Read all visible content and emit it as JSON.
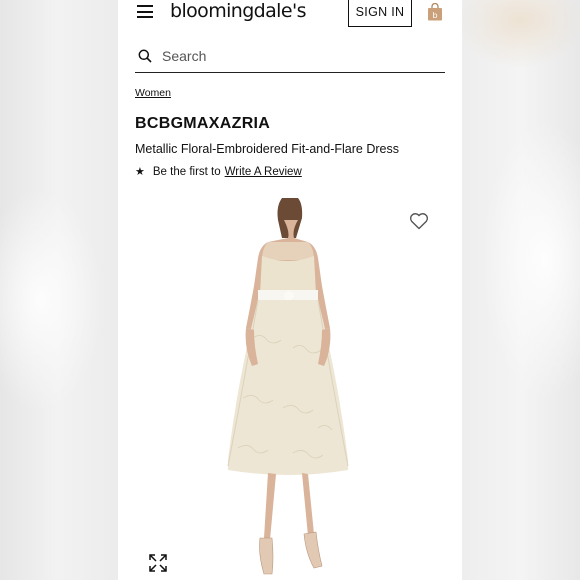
{
  "header": {
    "logo_text": "bloomingdale's",
    "signin_label": "SIGN IN",
    "bag_icon": "shopping-bag-icon",
    "menu_icon": "hamburger-menu-icon"
  },
  "search": {
    "placeholder": "Search",
    "icon": "search-icon"
  },
  "breadcrumb": {
    "label": "Women"
  },
  "product": {
    "brand": "BCBGMAXAZRIA",
    "name": "Metallic Floral-Embroidered Fit-and-Flare Dress",
    "review_prefix": "Be the first to",
    "review_link": "Write A Review",
    "star_glyph": "★"
  },
  "image": {
    "favorite_icon": "heart-icon",
    "expand_icon": "expand-icon",
    "dress_color": "#ede6d4"
  },
  "colors": {
    "text": "#111111",
    "bag_accent": "#c9a07a"
  }
}
